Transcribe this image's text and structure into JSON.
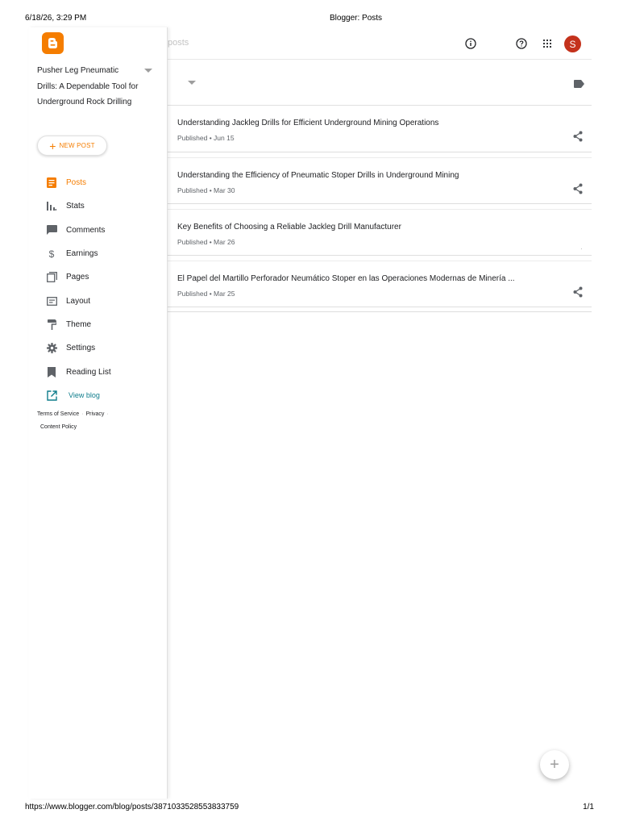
{
  "print_header": {
    "datetime": "6/18/26, 3:29 PM",
    "page_title": "Blogger: Posts"
  },
  "print_footer": {
    "url": "https://www.blogger.com/blog/posts/3871033528553833759",
    "page_count": "1/1"
  },
  "topbar": {
    "search_hint": "posts",
    "avatar_letter": "S",
    "icons": [
      "info-icon",
      "help-icon",
      "apps-icon"
    ]
  },
  "sidebar": {
    "blog_title": "Pusher Leg Pneumatic Drills: A Dependable Tool for Underground Rock Drilling",
    "new_post_label": "NEW POST",
    "nav_items": [
      {
        "label": "Posts",
        "icon": "posts-icon",
        "active": true
      },
      {
        "label": "Stats",
        "icon": "stats-icon"
      },
      {
        "label": "Comments",
        "icon": "comments-icon"
      },
      {
        "label": "Earnings",
        "icon": "earnings-icon"
      },
      {
        "label": "Pages",
        "icon": "pages-icon"
      },
      {
        "label": "Layout",
        "icon": "layout-icon"
      },
      {
        "label": "Theme",
        "icon": "theme-icon"
      },
      {
        "label": "Settings",
        "icon": "settings-icon"
      },
      {
        "label": "Reading List",
        "icon": "bookmark-icon"
      },
      {
        "label": "View blog",
        "icon": "open-external-icon"
      }
    ],
    "footer": {
      "terms": "Terms of Service",
      "privacy": "Privacy",
      "content_policy": "Content Policy"
    }
  },
  "posts": [
    {
      "title": "Understanding Jackleg Drills for Efficient Underground Mining Operations",
      "meta": "Published • Jun 15"
    },
    {
      "title": "Understanding the Efficiency of Pneumatic Stoper Drills in Underground Mining",
      "meta": "Published • Mar 30"
    },
    {
      "title": "Key Benefits of Choosing a Reliable Jackleg Drill Manufacturer",
      "meta": "Published • Mar 26"
    },
    {
      "title": "El Papel del Martillo Perforador Neumático Stoper en las Operaciones Modernas de Minería ...",
      "meta": "Published • Mar 25"
    }
  ],
  "fab_label": "+",
  "colors": {
    "accent": "#f57d00",
    "avatar": "#c4321c",
    "link": "#0f7d8c"
  }
}
